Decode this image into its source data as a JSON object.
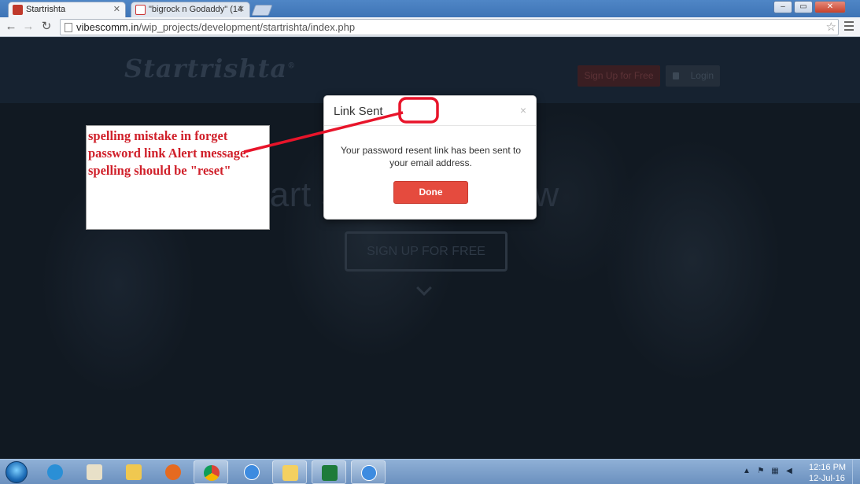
{
  "browser": {
    "tabs": [
      {
        "label": "Startrishta",
        "active": true
      },
      {
        "label": "\"bigrock n Godaddy\" (14",
        "active": false
      }
    ],
    "url_host": "vibescomm.in",
    "url_path": "/wip_projects/development/startrishta/index.php",
    "window_buttons": {
      "minimize": "–",
      "maximize": "▭",
      "close": "✕"
    }
  },
  "site": {
    "logo": "Startrishta",
    "logo_mark": "®",
    "header_signup": "Sign Up for Free",
    "header_login": "Login",
    "hero_heading": "tart something new",
    "hero_signup": "SIGN UP FOR FREE"
  },
  "modal": {
    "title": "Link Sent",
    "close": "×",
    "body": "Your password resent link has been sent to your email address.",
    "done": "Done"
  },
  "annotation": {
    "text": "spelling mistake in forget password link Alert message. spelling should be \"reset\"",
    "color": "#d0202a"
  },
  "taskbar": {
    "apps": [
      "start-orb-icon",
      "ie-icon",
      "paint-icon",
      "explorer-icon",
      "firefox-icon",
      "chrome-icon",
      "safari-icon",
      "outlook-icon",
      "excel-icon",
      "safari-icon"
    ],
    "clock_time": "12:16 PM",
    "clock_date": "12-Jul-16"
  }
}
